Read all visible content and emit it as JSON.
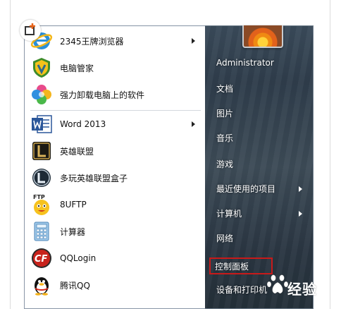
{
  "programs": [
    {
      "label": "2345王牌浏览器",
      "icon": "ie-browser-icon",
      "has_submenu": true
    },
    {
      "label": "电脑管家",
      "icon": "shield-icon",
      "has_submenu": false
    },
    {
      "label": "强力卸载电脑上的软件",
      "icon": "pinwheel-icon",
      "has_submenu": false
    },
    {
      "label": "Word 2013",
      "icon": "word-icon",
      "has_submenu": true
    },
    {
      "label": "英雄联盟",
      "icon": "lol-icon",
      "has_submenu": false
    },
    {
      "label": "多玩英雄联盟盒子",
      "icon": "lol-box-icon",
      "has_submenu": false
    },
    {
      "label": "8UFTP",
      "icon": "ftp-face-icon",
      "has_submenu": false
    },
    {
      "label": "计算器",
      "icon": "calculator-icon",
      "has_submenu": false
    },
    {
      "label": "QQLogin",
      "icon": "crossfire-icon",
      "has_submenu": false
    },
    {
      "label": "腾讯QQ",
      "icon": "qq-penguin-icon",
      "has_submenu": false
    }
  ],
  "right_items": [
    {
      "label": "Administrator",
      "has_submenu": false
    },
    {
      "label": "文档",
      "has_submenu": false
    },
    {
      "label": "图片",
      "has_submenu": false
    },
    {
      "label": "音乐",
      "has_submenu": false
    },
    {
      "label": "游戏",
      "has_submenu": false
    },
    {
      "label": "最近使用的项目",
      "has_submenu": true
    },
    {
      "label": "计算机",
      "has_submenu": true
    },
    {
      "label": "网络",
      "has_submenu": false
    },
    {
      "label": "控制面板",
      "has_submenu": false,
      "highlighted": true
    },
    {
      "label": "设备和打印机",
      "has_submenu": false
    }
  ],
  "watermark": {
    "text": "经验"
  },
  "colors": {
    "highlight_border": "#c81a1a",
    "panel_dark": "#2f3d4b"
  }
}
